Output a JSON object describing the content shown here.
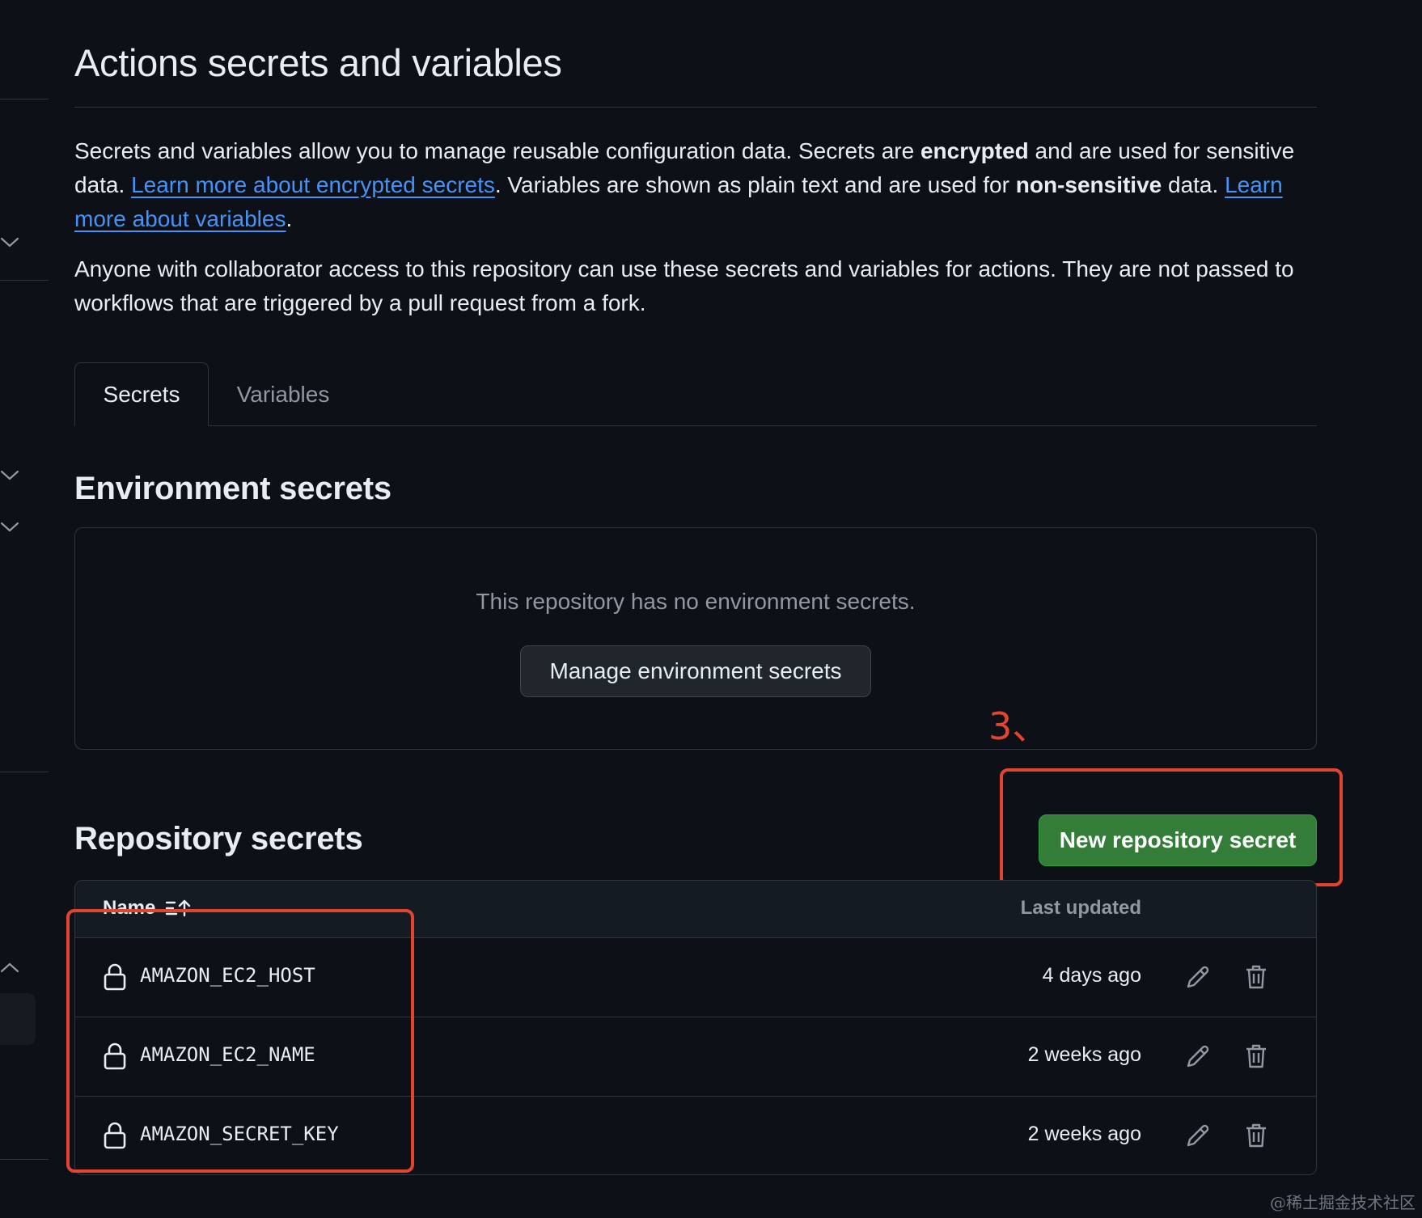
{
  "page": {
    "title": "Actions secrets and variables"
  },
  "intro": {
    "p1_a": "Secrets and variables allow you to manage reusable configuration data. Secrets are ",
    "p1_b": "encrypted",
    "p1_c": " and are used for sensitive data. ",
    "p1_link1": "Learn more about encrypted secrets",
    "p1_d": ". Variables are shown as plain text and are used for ",
    "p1_e": "non-sensitive",
    "p1_f": " data. ",
    "p1_link2": "Learn more about variables",
    "p1_g": ".",
    "p2": "Anyone with collaborator access to this repository can use these secrets and variables for actions. They are not passed to workflows that are triggered by a pull request from a fork."
  },
  "tabs": [
    {
      "label": "Secrets",
      "active": true
    },
    {
      "label": "Variables",
      "active": false
    }
  ],
  "environment": {
    "heading": "Environment secrets",
    "empty_message": "This repository has no environment secrets.",
    "manage_button": "Manage environment secrets"
  },
  "annotation": {
    "label": "3、",
    "color": "#e2452f"
  },
  "repository": {
    "heading": "Repository secrets",
    "new_button": "New repository secret",
    "columns": {
      "name": "Name",
      "last_updated": "Last updated"
    },
    "secrets": [
      {
        "name": "AMAZON_EC2_HOST",
        "updated": "4 days ago"
      },
      {
        "name": "AMAZON_EC2_NAME",
        "updated": "2 weeks ago"
      },
      {
        "name": "AMAZON_SECRET_KEY",
        "updated": "2 weeks ago"
      }
    ]
  },
  "icons": {
    "lock": "lock-icon",
    "edit": "pencil-icon",
    "delete": "trash-icon",
    "sort": "sort-asc-icon",
    "chevron": "chevron-icon"
  },
  "colors": {
    "background": "#0d1117",
    "link": "#4493f8",
    "primary_button": "#347d39",
    "border": "#30363d"
  },
  "watermark": "@稀土掘金技术社区"
}
